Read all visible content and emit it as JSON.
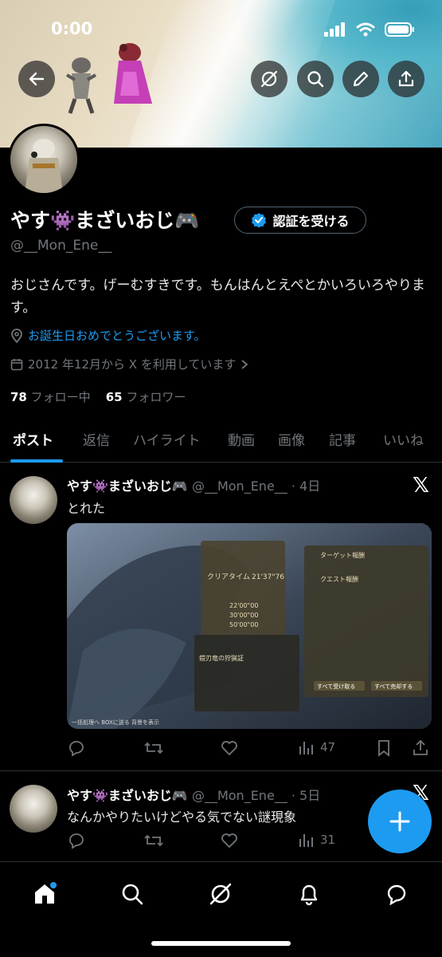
{
  "status_bar": {
    "time": "0:00"
  },
  "profile": {
    "name": "やす👾まざいおじ🎮",
    "handle": "@__Mon_Ene__",
    "verify_button": "認証を受ける",
    "bio": "おじさんです。げーむすきです。もんはんとえぺとかいろいろやります。",
    "location": "お誕生日おめでとうございます。",
    "joined": "2012 年12月から X を利用しています",
    "following_count": "78",
    "following_label": "フォロー中",
    "followers_count": "65",
    "followers_label": "フォロワー"
  },
  "tabs": [
    "ポスト",
    "返信",
    "ハイライト",
    "動画",
    "画像",
    "記事",
    "いいね"
  ],
  "posts": [
    {
      "name": "やす👾まざいおじ🎮",
      "handle": "@__Mon_Ene__",
      "time": "· 4日",
      "text": "とれた",
      "views": "47",
      "media": {
        "clear_time_label": "クリアタイム",
        "clear_time": "21'37\"76",
        "target_reward": "ターゲット報酬",
        "quest_reward": "クエスト報酬",
        "item_name": "鎧刃竜の狩猟証",
        "times": [
          "22'00\"00",
          "30'00\"00",
          "50'00\"00"
        ],
        "accept_all": "すべて受け取る",
        "sell_all": "すべて売却する",
        "footer": "一括処理へ  BOXに送る  背景を表示"
      }
    },
    {
      "name": "やす👾まざいおじ🎮",
      "handle": "@__Mon_Ene__",
      "time": "· 5日",
      "text": "なんかやりたいけどやる気でない謎現象",
      "views": "31"
    }
  ],
  "colors": {
    "accent": "#1d9bf0",
    "background": "#000000",
    "muted": "#71767b"
  }
}
